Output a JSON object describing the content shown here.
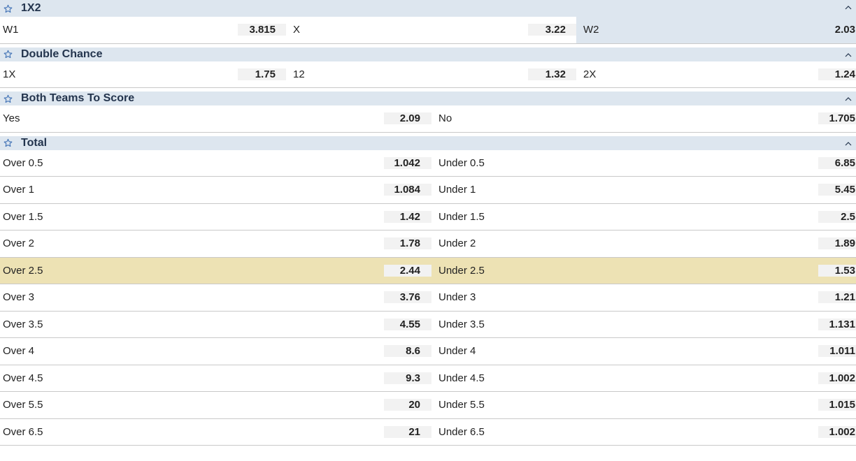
{
  "markets": {
    "m1x2": {
      "title": "1X2",
      "outcomes": [
        {
          "label": "W1",
          "odd": "3.815"
        },
        {
          "label": "X",
          "odd": "3.22"
        },
        {
          "label": "W2",
          "odd": "2.03"
        }
      ]
    },
    "double_chance": {
      "title": "Double Chance",
      "outcomes": [
        {
          "label": "1X",
          "odd": "1.75"
        },
        {
          "label": "12",
          "odd": "1.32"
        },
        {
          "label": "2X",
          "odd": "1.24"
        }
      ]
    },
    "btts": {
      "title": "Both Teams To Score",
      "outcomes": [
        {
          "label": "Yes",
          "odd": "2.09"
        },
        {
          "label": "No",
          "odd": "1.705"
        }
      ]
    },
    "total": {
      "title": "Total",
      "rows": [
        {
          "over_label": "Over 0.5",
          "over_odd": "1.042",
          "under_label": "Under 0.5",
          "under_odd": "6.85"
        },
        {
          "over_label": "Over 1",
          "over_odd": "1.084",
          "under_label": "Under 1",
          "under_odd": "5.45"
        },
        {
          "over_label": "Over 1.5",
          "over_odd": "1.42",
          "under_label": "Under 1.5",
          "under_odd": "2.5"
        },
        {
          "over_label": "Over 2",
          "over_odd": "1.78",
          "under_label": "Under 2",
          "under_odd": "1.89"
        },
        {
          "over_label": "Over 2.5",
          "over_odd": "2.44",
          "under_label": "Under 2.5",
          "under_odd": "1.53"
        },
        {
          "over_label": "Over 3",
          "over_odd": "3.76",
          "under_label": "Under 3",
          "under_odd": "1.21"
        },
        {
          "over_label": "Over 3.5",
          "over_odd": "4.55",
          "under_label": "Under 3.5",
          "under_odd": "1.131"
        },
        {
          "over_label": "Over 4",
          "over_odd": "8.6",
          "under_label": "Under 4",
          "under_odd": "1.011"
        },
        {
          "over_label": "Over 4.5",
          "over_odd": "9.3",
          "under_label": "Under 4.5",
          "under_odd": "1.002"
        },
        {
          "over_label": "Over 5.5",
          "over_odd": "20",
          "under_label": "Under 5.5",
          "under_odd": "1.015"
        },
        {
          "over_label": "Over 6.5",
          "over_odd": "21",
          "under_label": "Under 6.5",
          "under_odd": "1.002"
        }
      ]
    }
  },
  "icons": {
    "favorite": "star-outline-icon",
    "collapse": "chevron-up-icon"
  },
  "colors": {
    "header_bg": "#dde6ef",
    "title": "#23344d",
    "odd_bg": "#f2f2f2",
    "highlight": "#ede2b4",
    "star": "#3d6fb4"
  }
}
